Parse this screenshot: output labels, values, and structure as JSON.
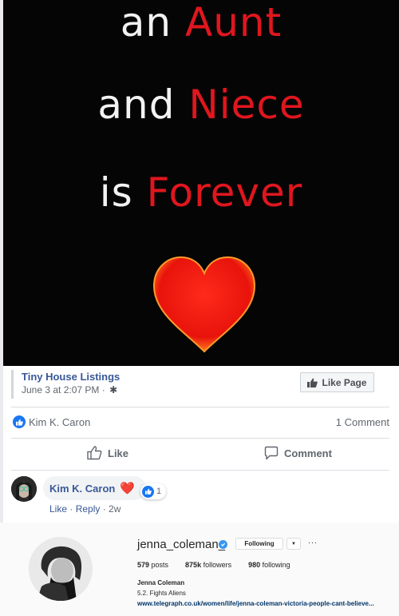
{
  "post": {
    "image_text": {
      "line1": {
        "white": "an ",
        "red": "Aunt"
      },
      "line2": {
        "white": "and ",
        "red": "Niece"
      },
      "line3": {
        "white": "is ",
        "red": "Forever"
      }
    },
    "page_name": "Tiny House Listings",
    "timestamp": "June 3 at 2:07 PM ·",
    "like_page_label": "Like Page",
    "reactor_name": "Kim K. Caron",
    "comment_count": "1 Comment",
    "like_action": "Like",
    "comment_action": "Comment"
  },
  "comment": {
    "author": "Kim K. Caron",
    "emoji": "❤️",
    "reaction_count": "1",
    "like_link": "Like",
    "sep1": " · ",
    "reply_link": "Reply",
    "sep2": " · ",
    "age": "2w"
  },
  "instagram": {
    "username": "jenna_coleman_",
    "following_label": "Following",
    "dropdown_symbol": "▼",
    "more_symbol": "···",
    "posts_count": "579",
    "posts_label": " posts",
    "followers_count": "875k",
    "followers_label": " followers",
    "following_count": "980",
    "following_label2": " following",
    "full_name": "Jenna Coleman",
    "bio": "5.2. Fights Aliens",
    "link": "www.telegraph.co.uk/women/life/jenna-coleman-victoria-people-cant-believe..."
  },
  "colors": {
    "fb_link": "#385898",
    "fb_blue": "#1877f2",
    "accent_red": "#e0161e",
    "ig_verified": "#3897f0",
    "ig_link": "#003569"
  }
}
